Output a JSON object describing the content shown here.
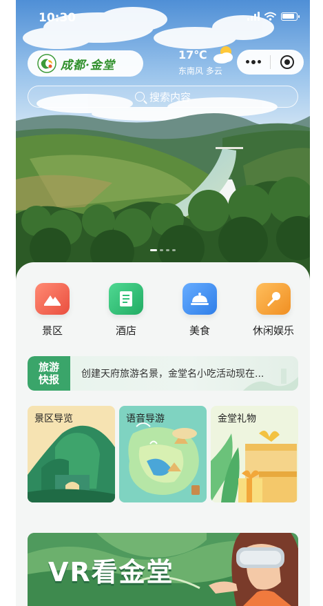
{
  "status_bar": {
    "time": "10:30"
  },
  "brand": {
    "name": "成都·金堂"
  },
  "weather": {
    "temperature": "17℃",
    "description": "东南风 多云"
  },
  "capsule": {
    "more_icon": "ellipsis-icon",
    "close_icon": "target-icon"
  },
  "search": {
    "placeholder": "搜索内容"
  },
  "carousel": {
    "slides": 4,
    "active": 1
  },
  "categories": [
    {
      "label": "景区",
      "icon": "mountain-icon",
      "color": "#ef6352"
    },
    {
      "label": "酒店",
      "icon": "hotel-document-icon",
      "color": "#2fbf78"
    },
    {
      "label": "美食",
      "icon": "food-cloche-icon",
      "color": "#3f8ff2"
    },
    {
      "label": "休闲娱乐",
      "icon": "microphone-icon",
      "color": "#f5a33a"
    }
  ],
  "news": {
    "badge_line1": "旅游",
    "badge_line2": "快报",
    "text": "创建天府旅游名景，金堂名小吃活动现在..."
  },
  "cards": [
    {
      "title": "景区导览"
    },
    {
      "title": "语音导游"
    },
    {
      "title": "金堂礼物"
    }
  ],
  "vr_banner": {
    "title": "VR看金堂"
  }
}
